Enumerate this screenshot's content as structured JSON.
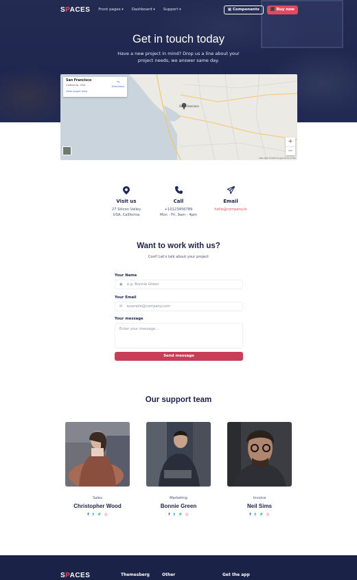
{
  "nav": {
    "logo_prefix": "S",
    "logo_accent": "P",
    "logo_suffix": "ACES",
    "links": [
      "Front pages",
      "Dashboard",
      "Support"
    ],
    "components_label": "Components",
    "buy_label": "Buy now"
  },
  "hero": {
    "title": "Get in touch today",
    "subtitle": "Have a new project in mind? Drop us a line about your project needs, we answer same day."
  },
  "map": {
    "place_title": "San Francisco",
    "place_subtitle": "California, USA",
    "larger_map_link": "View larger map",
    "directions_label": "Directions",
    "zoom_in": "+",
    "zoom_out": "−",
    "footer_text": "Map data ©2020 Google   Terms of Use",
    "city_label": "San Francisco"
  },
  "contact": [
    {
      "icon": "map-pin-icon",
      "glyph": "⬤",
      "title": "Visit us",
      "line1": "27 Silicon Valley",
      "line2": "USA, California"
    },
    {
      "icon": "phone-icon",
      "glyph": "✆",
      "title": "Call",
      "line1": "+10123456789",
      "line2": "Mon - Fri, 9am - 4pm"
    },
    {
      "icon": "send-icon",
      "glyph": "➤",
      "title": "Email",
      "line1": "hello@company.io",
      "line2": ""
    }
  ],
  "form": {
    "title": "Want to work with us?",
    "subtitle": "Cool! Let's talk about your project",
    "name_label": "Your Name",
    "name_placeholder": "e.g. Bonnie Green",
    "email_label": "Your Email",
    "email_placeholder": "example@company.com",
    "message_label": "Your message",
    "message_placeholder": "Enter your message...",
    "submit_label": "Send message"
  },
  "team": {
    "title": "Our support team",
    "members": [
      {
        "role": "Sales",
        "name": "Christopher Wood"
      },
      {
        "role": "Marketing",
        "name": "Bonnie Green"
      },
      {
        "role": "Invoice",
        "name": "Neil Sims"
      }
    ],
    "social_glyphs": {
      "facebook": "f",
      "twitter": "t",
      "slack": "#",
      "dribbble": "◎"
    }
  },
  "footer": {
    "col1": "Themesberg",
    "col2": "Other",
    "col3": "Get the app"
  },
  "colors": {
    "hero_bg": "#232b52",
    "accent_red": "#e04a60",
    "navy_text": "#1c2147",
    "footer_bg": "#1b2247"
  }
}
